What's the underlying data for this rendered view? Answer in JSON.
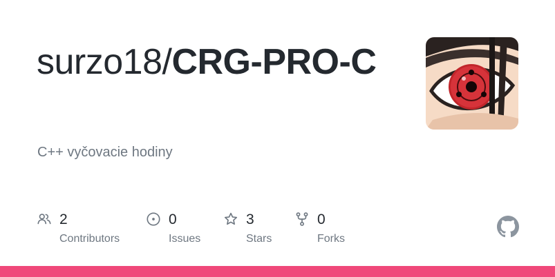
{
  "header": {
    "owner": "surzo18/",
    "repo": "CRG-PRO-C",
    "description": "C++ vyčovacie hodiny"
  },
  "avatar": {
    "icon": "sharingan-eye-avatar"
  },
  "stats": {
    "contributors": {
      "count": "2",
      "label": "Contributors",
      "icon": "people-icon"
    },
    "issues": {
      "count": "0",
      "label": "Issues",
      "icon": "issue-opened-icon"
    },
    "stars": {
      "count": "3",
      "label": "Stars",
      "icon": "star-icon"
    },
    "forks": {
      "count": "0",
      "label": "Forks",
      "icon": "repo-forked-icon"
    }
  },
  "footer": {
    "icon": "github-mark-icon"
  },
  "colors": {
    "text": "#24292f",
    "muted": "#6e7781",
    "bar": "#f0487a",
    "icon_gray": "#8c959f"
  }
}
